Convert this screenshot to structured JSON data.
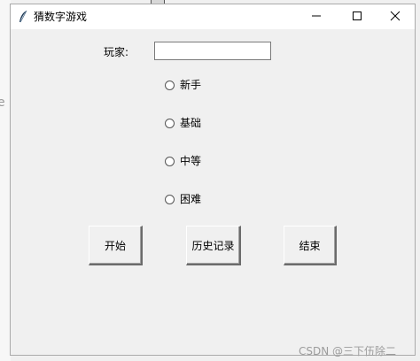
{
  "background": {
    "fragment_char": "e"
  },
  "window": {
    "title": "猜数字游戏",
    "controls": {
      "minimize_icon": "minimize-icon",
      "maximize_icon": "maximize-icon",
      "close_icon": "close-icon"
    }
  },
  "form": {
    "player_label": "玩家:",
    "player_value": "",
    "difficulty_options": [
      {
        "label": "新手",
        "selected": false
      },
      {
        "label": "基础",
        "selected": false
      },
      {
        "label": "中等",
        "selected": false
      },
      {
        "label": "困难",
        "selected": false
      }
    ]
  },
  "buttons": {
    "start": "开始",
    "history": "历史记录",
    "end": "结束"
  },
  "watermark": "CSDN @三下伍除二",
  "colors": {
    "window_bg": "#f0f0f0",
    "titlebar_bg": "#ffffff",
    "watermark": "#9c9c9c"
  }
}
